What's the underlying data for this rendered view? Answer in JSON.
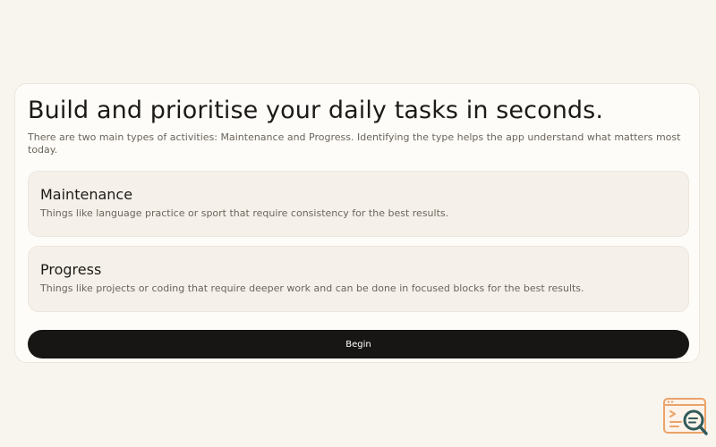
{
  "main": {
    "headline": "Build and prioritise your daily tasks in seconds.",
    "intro": "There are two main types of activities: Maintenance and Progress. Identifying the type helps the app understand what matters most today.",
    "options": [
      {
        "title": "Maintenance",
        "description": "Things like language practice or sport that require consistency for the best results."
      },
      {
        "title": "Progress",
        "description": "Things like projects or coding that require deeper work and can be done in focused blocks for the best results."
      }
    ],
    "begin_label": "Begin"
  },
  "widget": {
    "icon": "search-debug-icon",
    "accent_color": "#e9a36a",
    "lens_color": "#2f5a5a"
  }
}
